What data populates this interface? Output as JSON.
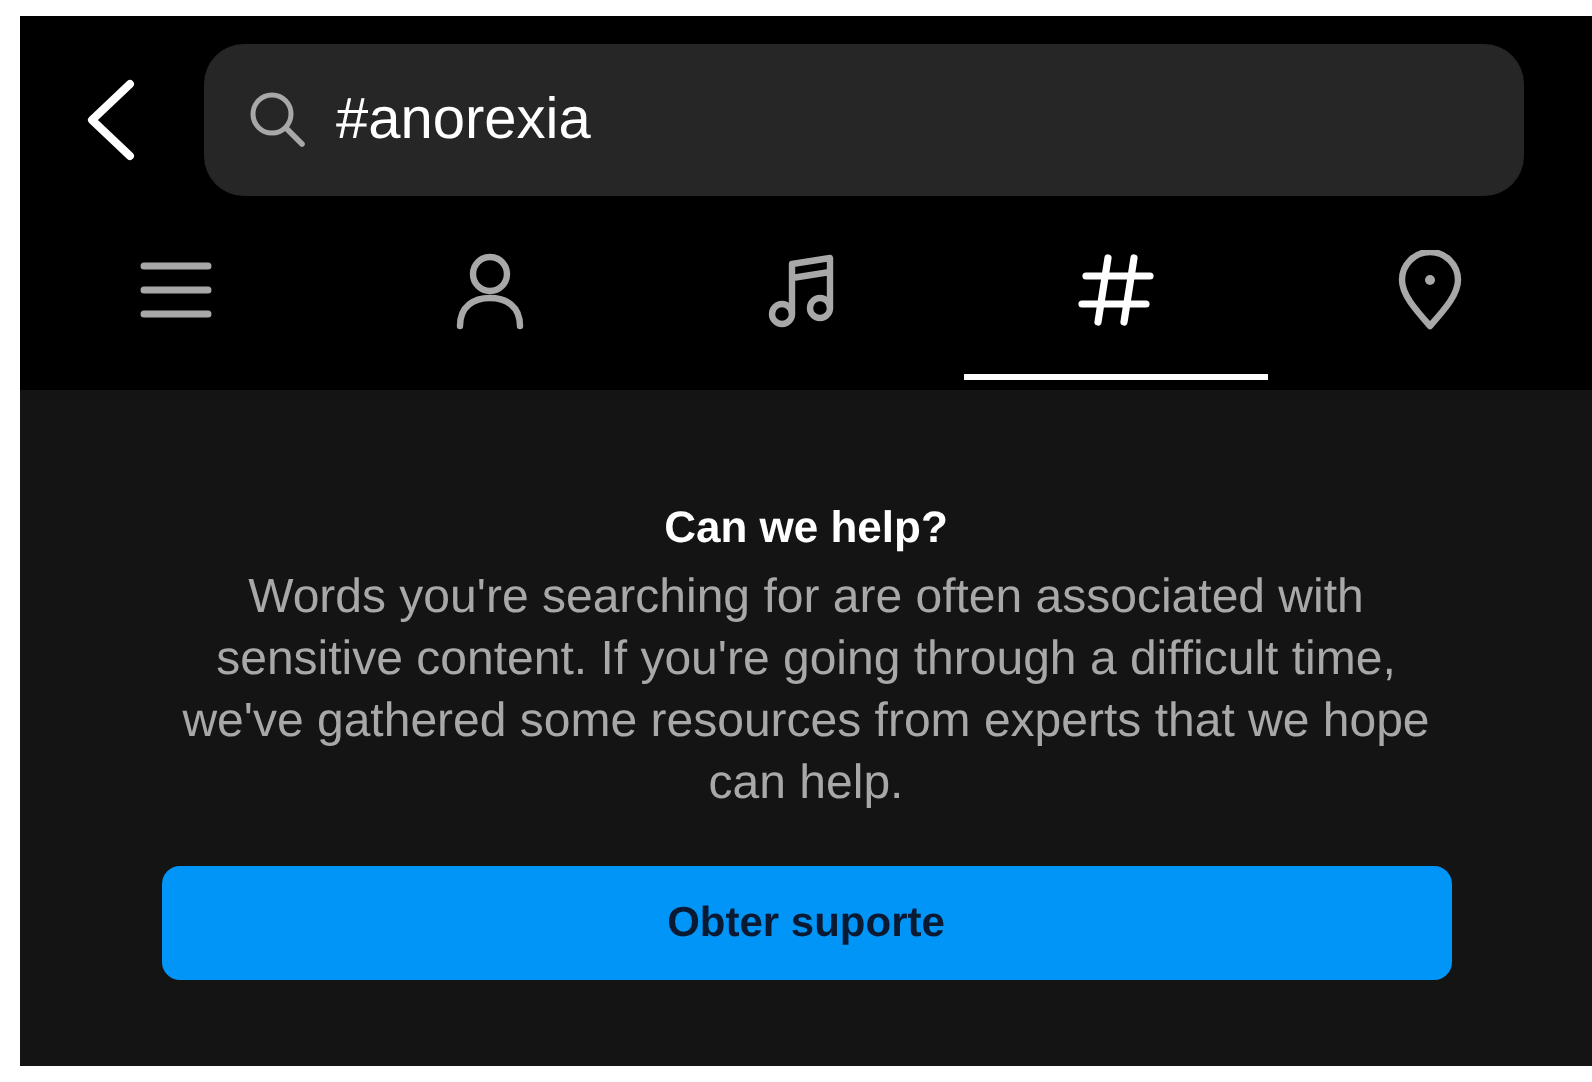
{
  "search": {
    "value": "#anorexia"
  },
  "tabs": [
    {
      "kind": "list",
      "selected": false
    },
    {
      "kind": "person",
      "selected": false
    },
    {
      "kind": "music",
      "selected": false
    },
    {
      "kind": "hashtag",
      "selected": true
    },
    {
      "kind": "place",
      "selected": false
    }
  ],
  "notice": {
    "title": "Can we help?",
    "text": "Words you're searching for are often associated with sensitive content. If you're going through a difficult time, we've gathered some resources from experts that we hope can help.",
    "button": "Obter suporte"
  }
}
